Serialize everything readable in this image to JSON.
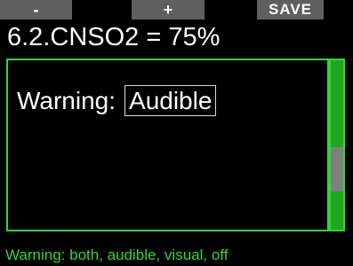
{
  "softkeys": {
    "minus": "-",
    "plus": "+",
    "save": "SAVE"
  },
  "title": "6.2.CNSO2 = 75%",
  "setting": {
    "label": "Warning:",
    "value": "Audible"
  },
  "hint": "Warning: both, audible, visual, off",
  "colors": {
    "background": "#000000",
    "accent": "#35d435",
    "softkey": "#5f5f5f",
    "scroll_thumb": "#7f7f7f"
  }
}
